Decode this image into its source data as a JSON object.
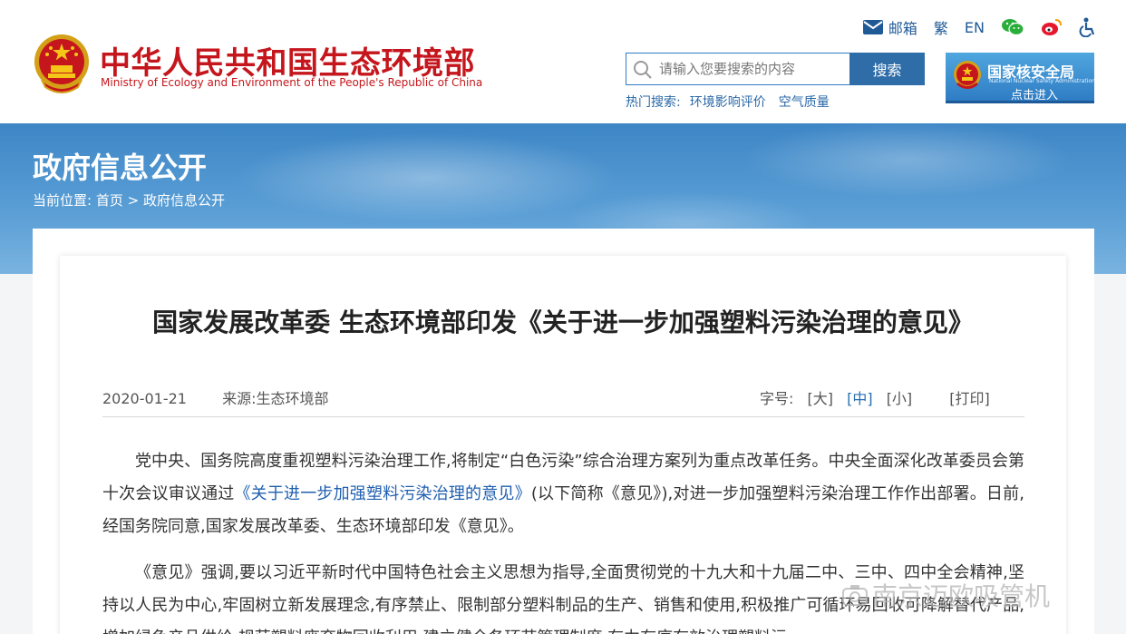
{
  "header": {
    "site_name_cn": "中华人民共和国生态环境部",
    "site_name_en": "Ministry of Ecology and Environment of the People's Republic of China",
    "toplinks": {
      "mail": "邮箱",
      "traditional": "繁",
      "english": "EN"
    },
    "icons": [
      "mail-icon",
      "wechat-icon",
      "weibo-icon",
      "accessibility-icon"
    ],
    "search": {
      "placeholder": "请输入您要搜索的内容",
      "button": "搜索"
    },
    "hot_search": {
      "label": "热门搜索:",
      "items": [
        "环境影响评价",
        "空气质量"
      ]
    },
    "nnsa": {
      "title": "国家核安全局",
      "subtitle": "National Nuclear Safety Administration",
      "enter": "点击进入"
    },
    "colors": {
      "brand_red": "#c4161c",
      "link_blue": "#2a68a8",
      "button_blue": "#2f6da9"
    }
  },
  "banner": {
    "title": "政府信息公开",
    "breadcrumb": {
      "prefix": "当前位置:",
      "home": "首页",
      "separator": ">",
      "current": "政府信息公开"
    }
  },
  "article": {
    "title": "国家发展改革委 生态环境部印发《关于进一步加强塑料污染治理的意见》",
    "date": "2020-01-21",
    "source": "来源:生态环境部",
    "font_size": {
      "label": "字号:",
      "large": "[大]",
      "medium": "[中]",
      "small": "[小]",
      "selected": "中"
    },
    "print": "[打印]",
    "p1_before": "党中央、国务院高度重视塑料污染治理工作,将制定“白色污染”综合治理方案列为重点改革任务。中央全面深化改革委员会第十次会议审议通过",
    "p1_link": "《关于进一步加强塑料污染治理的意见》",
    "p1_after": "(以下简称《意见》),对进一步加强塑料污染治理工作作出部署。日前,经国务院同意,国家发展改革委、生态环境部印发《意见》。",
    "p2": "《意见》强调,要以习近平新时代中国特色社会主义思想为指导,全面贯彻党的十九大和十九届二中、三中、四中全会精神,坚持以人民为中心,牢固树立新发展理念,有序禁止、限制部分塑料制品的生产、销售和使用,积极推广可循环易回收可降解替代产品,增加绿色产品供给,规范塑料废弃物回收利用,建立健全各环节管理制度,有力有序有效治理塑料污"
  },
  "watermark": "南京迈欧吸管机"
}
